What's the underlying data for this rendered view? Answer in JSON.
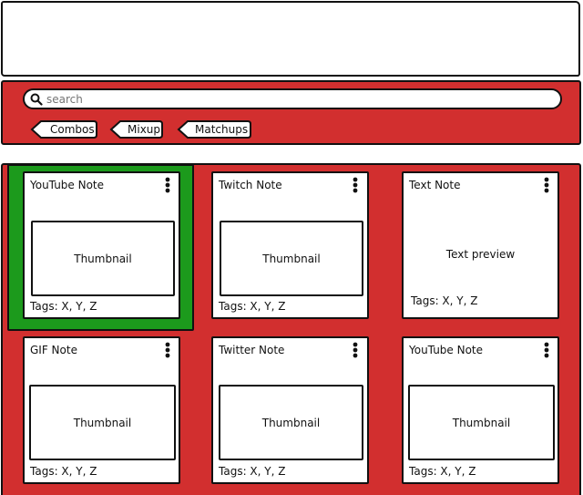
{
  "search": {
    "placeholder": "search"
  },
  "filters": [
    {
      "label": "Combos"
    },
    {
      "label": "Mixup"
    },
    {
      "label": "Matchups"
    }
  ],
  "notes": [
    {
      "title": "YouTube Note",
      "body": "Thumbnail",
      "tags": "Tags: X, Y, Z",
      "selected": true
    },
    {
      "title": "Twitch Note",
      "body": "Thumbnail",
      "tags": "Tags: X, Y, Z"
    },
    {
      "title": "Text Note",
      "body": "Text preview",
      "tags": "Tags: X, Y, Z"
    },
    {
      "title": "GIF Note",
      "body": "Thumbnail",
      "tags": "Tags: X, Y, Z"
    },
    {
      "title": "Twitter Note",
      "body": "Thumbnail",
      "tags": "Tags: X, Y, Z"
    },
    {
      "title": "YouTube Note",
      "body": "Thumbnail",
      "tags": "Tags: X, Y, Z"
    }
  ],
  "colors": {
    "accent_red": "#d22f2f",
    "selected_green": "#1c9a1c",
    "ink": "#111111"
  },
  "icons": {
    "search": "search-icon",
    "note_menu": "kebab-menu-icon",
    "filter_tag": "tag-icon"
  }
}
